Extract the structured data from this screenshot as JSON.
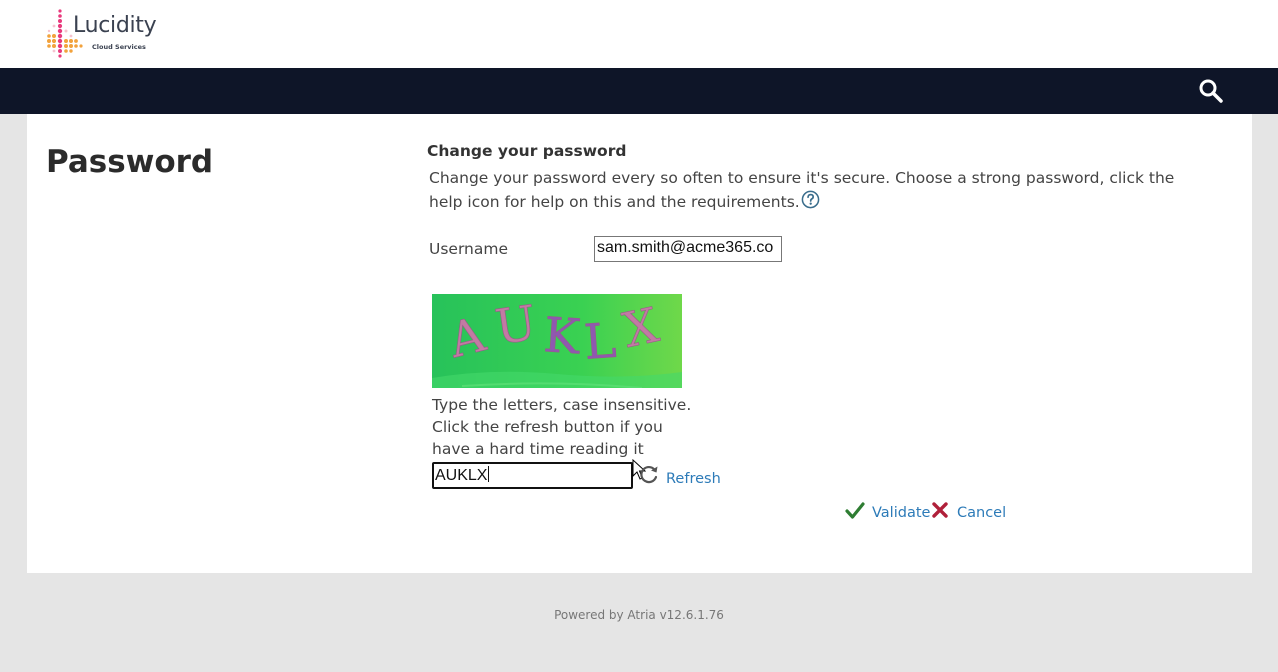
{
  "brand": {
    "name": "Lucidity",
    "tagline": "Cloud Services"
  },
  "page": {
    "title": "Password"
  },
  "form": {
    "section_title": "Change your password",
    "description": "Change your password every so often to ensure it's secure. Choose a strong password, click the help icon for help on this and the requirements.",
    "username_label": "Username",
    "username_value": "sam.smith@acme365.co",
    "captcha_text": "AUKLX",
    "captcha_help": "Type the letters, case insensitive. Click the refresh button if you have a hard time reading it",
    "captcha_input_value": "AUKLX",
    "refresh_label": "Refresh",
    "validate_label": "Validate",
    "cancel_label": "Cancel"
  },
  "footer": {
    "text": "Powered by Atria v12.6.1.76"
  },
  "icons": {
    "search": "search-icon",
    "help": "help-icon",
    "refresh": "refresh-icon",
    "validate": "checkmark-icon",
    "cancel": "close-icon"
  },
  "colors": {
    "navbar": "#0e1528",
    "link": "#2d7bb8",
    "validate_check": "#2e7d32",
    "cancel_x": "#b0203a",
    "captcha_bg": "#3ccf5a",
    "background": "#e5e5e5"
  }
}
